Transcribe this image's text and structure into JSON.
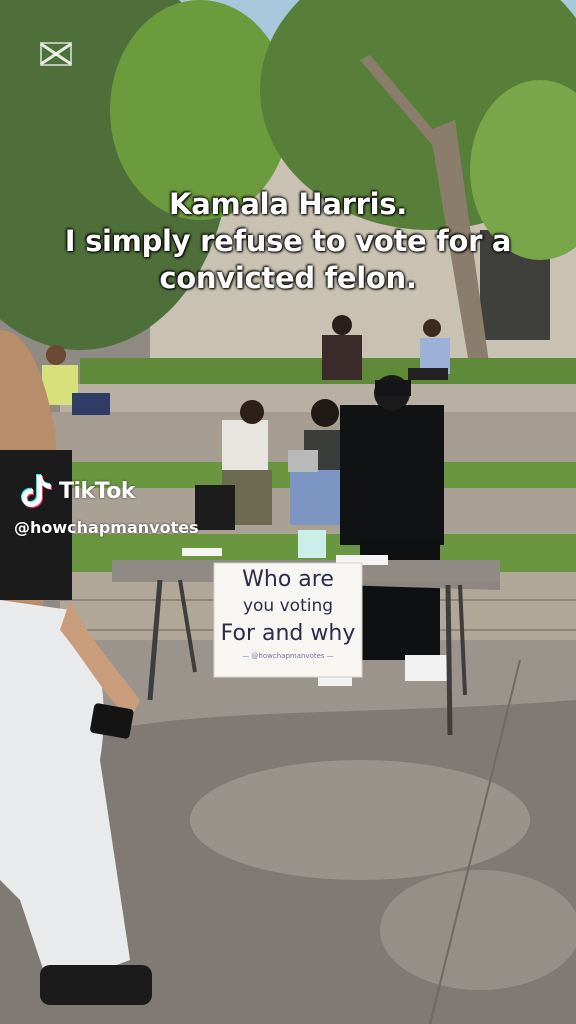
{
  "caption": {
    "line1": "Kamala Harris.",
    "line2": "I simply refuse to vote for a",
    "line3": "convicted felon."
  },
  "watermark": {
    "brand": "TikTok",
    "handle": "@howchapmanvotes",
    "editor_icon": "capcut-icon"
  },
  "sign": {
    "line1": "Who are",
    "line2": "you voting",
    "line3": "For and why",
    "line4": "— @howchapmanvotes —"
  },
  "colors": {
    "caption_text": "#ffffff",
    "sign_ink": "#2b2d4a",
    "grass": "#5f8a3a",
    "pavement": "#9a948d"
  }
}
